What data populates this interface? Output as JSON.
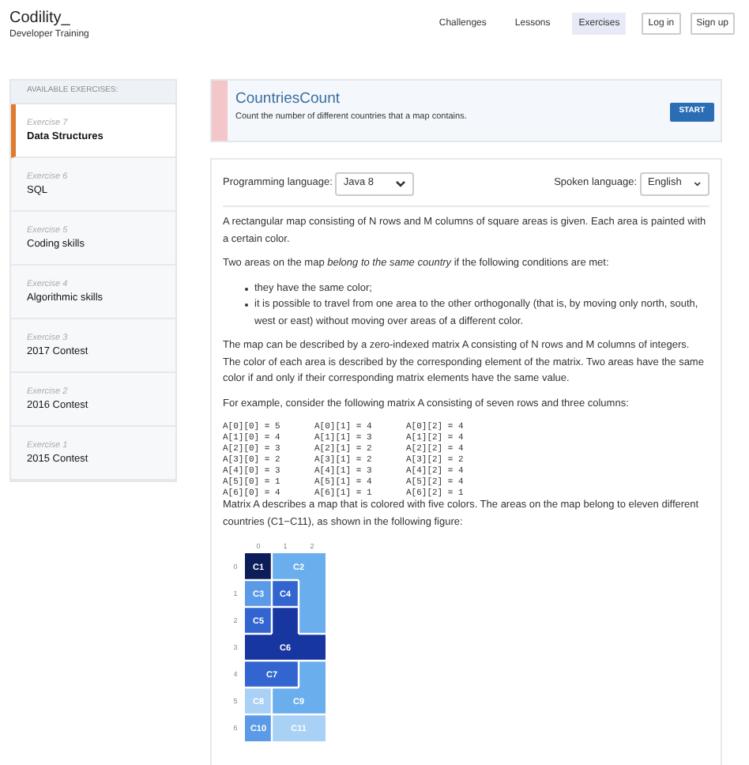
{
  "header": {
    "logo": "Codility_",
    "subtitle": "Developer Training",
    "nav": [
      {
        "label": "Challenges",
        "kind": "link",
        "selected": false
      },
      {
        "label": "Lessons",
        "kind": "link",
        "selected": false
      },
      {
        "label": "Exercises",
        "kind": "link",
        "selected": true
      },
      {
        "label": "Log in",
        "kind": "button",
        "selected": false
      },
      {
        "label": "Sign up",
        "kind": "button",
        "selected": false
      }
    ]
  },
  "sidebar": {
    "title": "AVAILABLE EXERCISES:",
    "items": [
      {
        "number": "Exercise 7",
        "name": "Data Structures",
        "selected": true
      },
      {
        "number": "Exercise 6",
        "name": "SQL",
        "selected": false
      },
      {
        "number": "Exercise 5",
        "name": "Coding skills",
        "selected": false
      },
      {
        "number": "Exercise 4",
        "name": "Algorithmic skills",
        "selected": false
      },
      {
        "number": "Exercise 3",
        "name": "2017 Contest",
        "selected": false
      },
      {
        "number": "Exercise 2",
        "name": "2016 Contest",
        "selected": false
      },
      {
        "number": "Exercise 1",
        "name": "2015 Contest",
        "selected": false
      }
    ]
  },
  "task": {
    "title": "CountriesCount",
    "summary": "Count the number of different countries that a map contains.",
    "button": "START"
  },
  "settings": {
    "programming_label": "Programming language:",
    "programming_value": "Java 8",
    "spoken_label": "Spoken language:",
    "spoken_value": "English"
  },
  "description": {
    "intro": [
      "A rectangular map consisting of N rows and M columns of square areas is given. Each area is painted with a certain color.",
      "Two areas on the map *belong to the same country* if the following conditions are met:"
    ],
    "bullets": [
      "they have the same color;",
      "it is possible to travel from one area to the other orthogonally (that is, by moving only north, south, west or east) without moving over areas of a different color."
    ],
    "middle": [
      "The map can be described by a zero-indexed matrix A consisting of N rows and M columns of integers. The color of each area is described by the corresponding element of the matrix. Two areas have the same color if and only if their corresponding matrix elements have the same value.",
      "For example, consider the following matrix A consisting of seven rows and three columns:"
    ],
    "code_rows": [
      [
        "A[0][0] = 5",
        "A[0][1] = 4",
        "A[0][2] = 4"
      ],
      [
        "A[1][0] = 4",
        "A[1][1] = 3",
        "A[1][2] = 4"
      ],
      [
        "A[2][0] = 3",
        "A[2][1] = 2",
        "A[2][2] = 4"
      ],
      [
        "A[3][0] = 2",
        "A[3][1] = 2",
        "A[3][2] = 2"
      ],
      [
        "A[4][0] = 3",
        "A[4][1] = 3",
        "A[4][2] = 4"
      ],
      [
        "A[5][0] = 1",
        "A[5][1] = 4",
        "A[5][2] = 4"
      ],
      [
        "A[6][0] = 4",
        "A[6][1] = 1",
        "A[6][2] = 1"
      ]
    ],
    "after": "Matrix A describes a map that is colored with five colors. The areas on the map belong to eleven different countries (C1−C11), as shown in the following figure:"
  },
  "figure": {
    "column_labels": [
      "0",
      "1",
      "2"
    ],
    "row_labels": [
      "0",
      "1",
      "2",
      "3",
      "4",
      "5",
      "6"
    ],
    "countries": [
      {
        "label": "C1",
        "color": "#0c1d5a"
      },
      {
        "label": "C2",
        "color": "#6aaeed"
      },
      {
        "label": "C3",
        "color": "#5b9ae6"
      },
      {
        "label": "C4",
        "color": "#3265cf"
      },
      {
        "label": "C5",
        "color": "#3265cf"
      },
      {
        "label": "C6",
        "color": "#1836a0"
      },
      {
        "label": "C7",
        "color": "#3265cf"
      },
      {
        "label": "C8",
        "color": "#a9d0f5"
      },
      {
        "label": "C9",
        "color": "#6aaeed"
      },
      {
        "label": "C10",
        "color": "#5b9ae6"
      },
      {
        "label": "C11",
        "color": "#a9d0f5"
      }
    ]
  }
}
